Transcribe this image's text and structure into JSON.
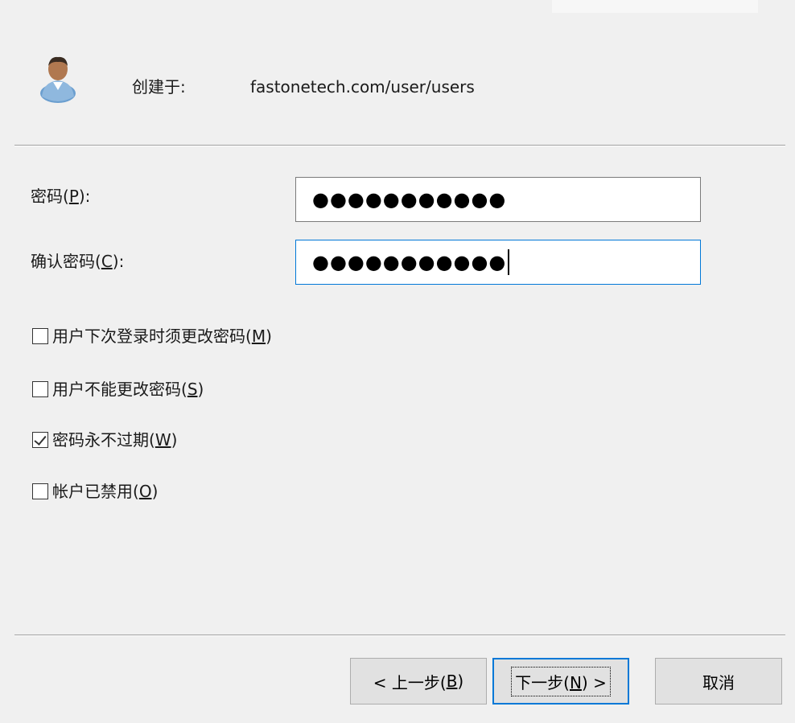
{
  "header": {
    "created_label": "创建于:",
    "created_value": "fastonetech.com/user/users",
    "icon": "user-icon"
  },
  "fields": {
    "password_label_prefix": "密码(",
    "password_label_key": "P",
    "password_label_suffix": "):",
    "password_value": "●●●●●●●●●●●",
    "confirm_label_prefix": "确认密码(",
    "confirm_label_key": "C",
    "confirm_label_suffix": "):",
    "confirm_value": "●●●●●●●●●●●"
  },
  "options": [
    {
      "prefix": "用户下次登录时须更改密码(",
      "key": "M",
      "suffix": ")",
      "checked": false
    },
    {
      "prefix": "用户不能更改密码(",
      "key": "S",
      "suffix": ")",
      "checked": false
    },
    {
      "prefix": "密码永不过期(",
      "key": "W",
      "suffix": ")",
      "checked": true
    },
    {
      "prefix": "帐户已禁用(",
      "key": "O",
      "suffix": ")",
      "checked": false
    }
  ],
  "buttons": {
    "back_prefix": "< 上一步(",
    "back_key": "B",
    "back_suffix": ")",
    "next_prefix": "下一步(",
    "next_key": "N",
    "next_suffix": ") >",
    "cancel": "取消"
  },
  "colors": {
    "accent": "#0078d7",
    "background": "#f0f0f0"
  }
}
